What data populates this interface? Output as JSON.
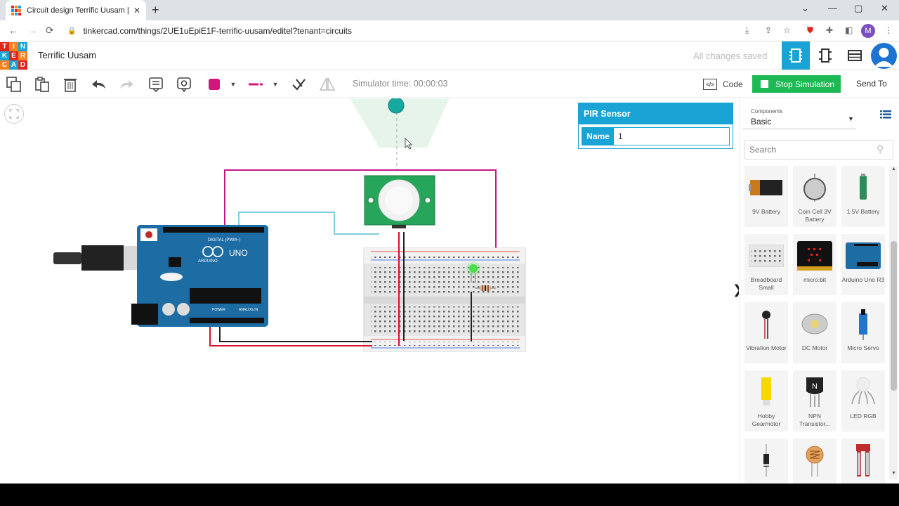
{
  "browser": {
    "tab_title": "Circuit design Terrific Uusam | Tin",
    "tab_close": "✕",
    "new_tab": "+",
    "url": "tinkercad.com/things/2UE1uEpiE1F-terrific-uusam/editel?tenant=circuits",
    "profile_initial": "M",
    "window_controls": [
      "⌄",
      "—",
      "▢",
      "✕"
    ]
  },
  "app": {
    "logo_letters": [
      "T",
      "I",
      "N",
      "K",
      "E",
      "R",
      "C",
      "A",
      "D"
    ],
    "logo_colors": [
      "#e2231a",
      "#f58220",
      "#1aa3d5",
      "#1aa3d5",
      "#e2231a",
      "#f58220",
      "#f58220",
      "#1aa3d5",
      "#e2231a"
    ],
    "title": "Terrific Uusam",
    "save_status": "All changes saved"
  },
  "toolbar": {
    "sim_time": "Simulator time: 00:00:03",
    "code_label": "Code",
    "code_icon_text": "</>",
    "stop_label": "Stop Simulation",
    "send_to_label": "Send To",
    "color_swatch": "#d4157a"
  },
  "inspector": {
    "component": "PIR Sensor",
    "name_label": "Name",
    "name_value": "1"
  },
  "sidebar": {
    "components_label": "Components",
    "components_value": "Basic",
    "search_placeholder": "Search",
    "items": [
      {
        "label": "9V Battery",
        "icon": "battery-9v-icon"
      },
      {
        "label": "Coin Cell 3V Battery",
        "icon": "coin-cell-icon"
      },
      {
        "label": "1.5V Battery",
        "icon": "battery-aa-icon"
      },
      {
        "label": "Breadboard Small",
        "icon": "breadboard-icon"
      },
      {
        "label": "micro:bit",
        "icon": "microbit-icon"
      },
      {
        "label": "Arduino Uno R3",
        "icon": "arduino-icon"
      },
      {
        "label": "Vibration Motor",
        "icon": "vibration-motor-icon"
      },
      {
        "label": "DC Motor",
        "icon": "dc-motor-icon"
      },
      {
        "label": "Micro Servo",
        "icon": "servo-icon"
      },
      {
        "label": "Hobby Gearmotor",
        "icon": "gearmotor-icon"
      },
      {
        "label": "NPN Transistor...",
        "icon": "transistor-icon"
      },
      {
        "label": "LED RGB",
        "icon": "led-rgb-icon"
      },
      {
        "label": "",
        "icon": "diode-icon"
      },
      {
        "label": "",
        "icon": "photoresistor-icon"
      },
      {
        "label": "",
        "icon": "soil-sensor-icon"
      }
    ]
  },
  "board": {
    "arduino_brand": "ARDUINO",
    "arduino_model": "UNO",
    "digital_label": "DIGITAL (PWM~)",
    "power_label": "POWER",
    "analog_label": "ANALOG IN"
  }
}
